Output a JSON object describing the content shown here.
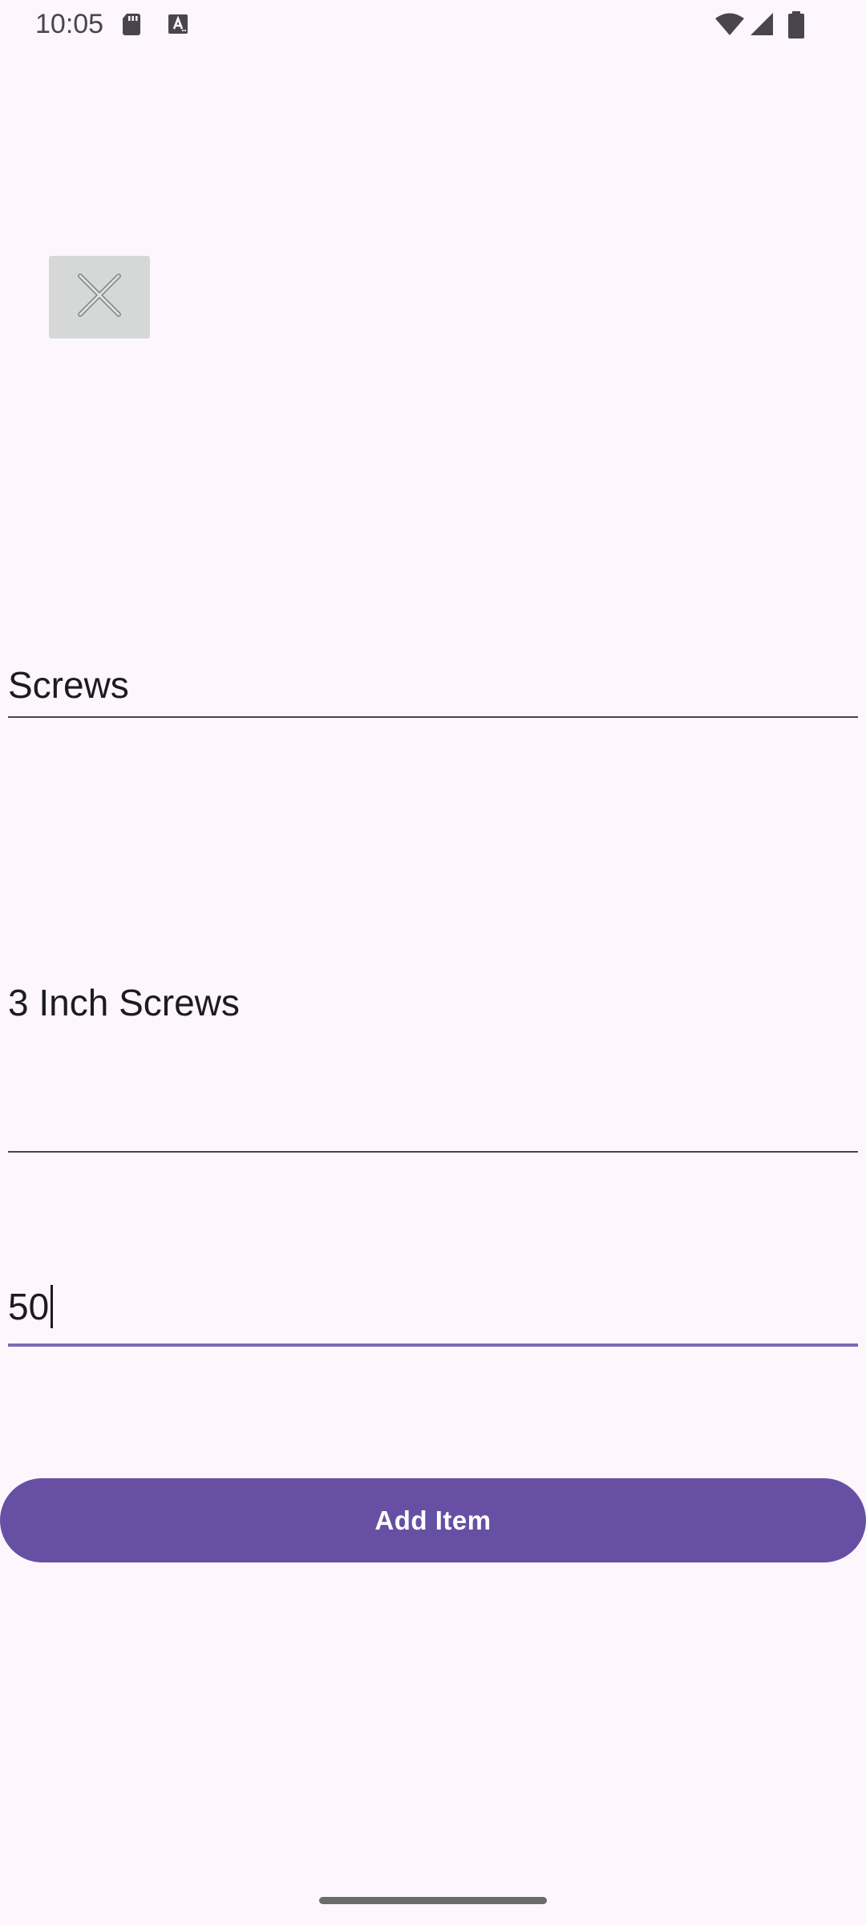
{
  "status_bar": {
    "time": "10:05",
    "left_icons": [
      "sd-card-icon",
      "keyboard-a-icon"
    ],
    "right_icons": [
      "wifi-icon",
      "signal-icon",
      "battery-icon"
    ]
  },
  "image_placeholder": {
    "icon": "close-icon"
  },
  "form": {
    "name_value": "Screws",
    "description_value": "3 Inch Screws",
    "quantity_value": "50"
  },
  "actions": {
    "add_label": "Add Item"
  },
  "colors": {
    "background": "#fdf6fc",
    "accent": "#6750a4",
    "placeholder_bg": "#d6d8d7"
  }
}
